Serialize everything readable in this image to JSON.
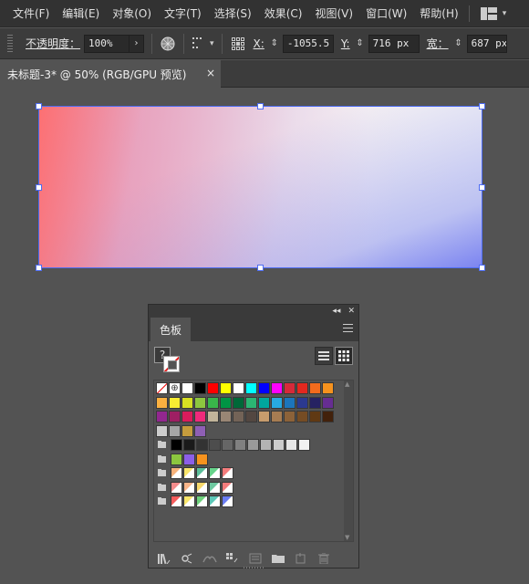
{
  "menubar": {
    "items": [
      "文件(F)",
      "编辑(E)",
      "对象(O)",
      "文字(T)",
      "选择(S)",
      "效果(C)",
      "视图(V)",
      "窗口(W)",
      "帮助(H)"
    ],
    "workspace_icon": "workspace-switcher-icon"
  },
  "controlbar": {
    "opacity_label": "不透明度：",
    "opacity_value": "100%",
    "opacity_menu": "›",
    "x_label": "X:",
    "x_value": "-1055.5 p",
    "y_label": "Y:",
    "y_value": "716 px",
    "w_label": "宽：",
    "w_value": "687 px"
  },
  "tabs": {
    "doc_title": "未标题-3* @ 50% (RGB/GPU 预览)",
    "close": "×"
  },
  "swatches_panel": {
    "tab_label": "色板",
    "fill_mark": "?",
    "rows": [
      [
        "none",
        "reg",
        "#ffffff",
        "#000000",
        "#ff0000",
        "#ffff00",
        "#ffffff",
        "#00ffff",
        "#0000ff",
        "#ff00ff",
        "#d62a3a",
        "#e3281f",
        "#f26b1d",
        "#f6921e"
      ],
      [
        "#fbb040",
        "#f9ed32",
        "#d7df23",
        "#8dc63f",
        "#39b54a",
        "#009444",
        "#006838",
        "#2bb673",
        "#00a79d",
        "#27aae1",
        "#1c75bc",
        "#2b3990",
        "#262262",
        "#662d91"
      ],
      [
        "#92278f",
        "#9e1f63",
        "#da1c5c",
        "#ee2a7b",
        "#c2b59b",
        "#998675",
        "#736357",
        "#534741",
        "#c69c6d",
        "#a67c52",
        "#8c6239",
        "#754c24",
        "#603913",
        "#42210b"
      ],
      [
        "#cccccc",
        "#a6a6a6",
        "#c69c3d",
        "#8e5fb4"
      ],
      [
        "#000000",
        "#1a1a1a",
        "#333333",
        "#4d4d4d",
        "#666666",
        "#808080",
        "#999999",
        "#b3b3b3",
        "#cccccc",
        "#e6e6e6",
        "#f2f2f2"
      ],
      [
        "#8cc63f",
        "#8c5fe8",
        "#f7931e"
      ],
      [
        "#f7b27a",
        "#f9e56b",
        "#5bbf9a",
        "#66d38a",
        "#f47c7c"
      ],
      [
        "#f48c8c",
        "#f8b58a",
        "#f8d86a",
        "#6ec9a0",
        "#f47c7c"
      ],
      [
        "#f45c5c",
        "#f9e56b",
        "#6ed17c",
        "#5cc8b8",
        "#6a7cf2"
      ]
    ],
    "footer_icons": [
      "swatch-libraries-icon",
      "place-swatch-icon",
      "swatch-kinds-icon",
      "swatch-options-icon",
      "new-color-group-icon",
      "new-swatch-icon",
      "delete-swatch-icon"
    ]
  }
}
